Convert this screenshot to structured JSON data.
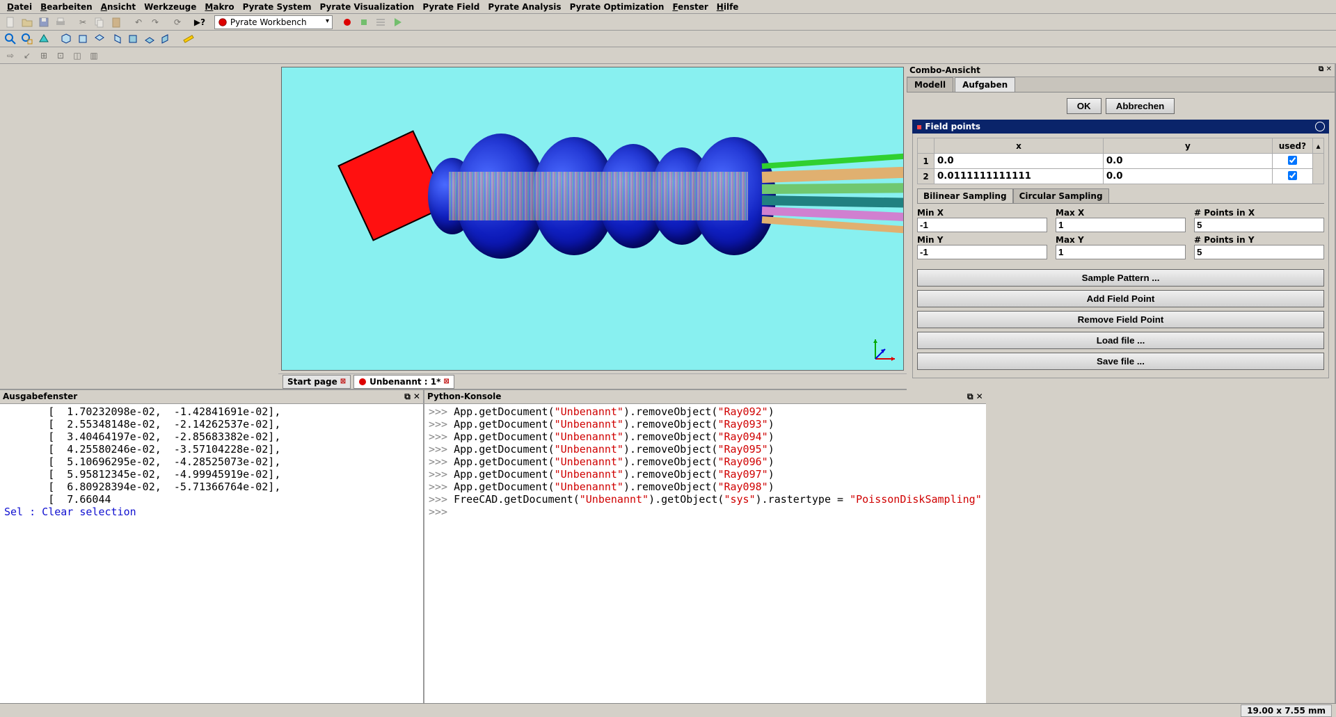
{
  "menu": {
    "datei": "Datei",
    "bearbeiten": "Bearbeiten",
    "ansicht": "Ansicht",
    "werkzeuge": "Werkzeuge",
    "makro": "Makro",
    "psystem": "Pyrate System",
    "pvisual": "Pyrate Visualization",
    "pfield": "Pyrate Field",
    "panalysis": "Pyrate Analysis",
    "poptim": "Pyrate Optimization",
    "fenster": "Fenster",
    "hilfe": "Hilfe"
  },
  "workbench": "Pyrate Workbench",
  "combo": {
    "title": "Combo-Ansicht",
    "tab_model": "Modell",
    "tab_tasks": "Aufgaben",
    "ok": "OK",
    "cancel": "Abbrechen",
    "section": "Field points",
    "col_x": "x",
    "col_y": "y",
    "col_used": "used?",
    "rows": [
      {
        "n": "1",
        "x": "0.0",
        "y": "0.0",
        "used": true
      },
      {
        "n": "2",
        "x": "0.0111111111111",
        "y": "0.0",
        "used": true
      }
    ],
    "sampling_bilinear": "Bilinear Sampling",
    "sampling_circular": "Circular Sampling",
    "minx_label": "Min X",
    "maxx_label": "Max X",
    "pointsx_label": "# Points in X",
    "miny_label": "Min Y",
    "maxy_label": "Max Y",
    "pointsy_label": "# Points in Y",
    "minx": "-1",
    "maxx": "1",
    "pointsx": "5",
    "miny": "-1",
    "maxy": "1",
    "pointsy": "5",
    "btn_sample": "Sample Pattern ...",
    "btn_add": "Add Field Point",
    "btn_remove": "Remove Field Point",
    "btn_load": "Load file ...",
    "btn_save": "Save file ..."
  },
  "doc_tabs": {
    "start": "Start page",
    "unbenannt": "Unbenannt : 1*"
  },
  "output": {
    "title": "Ausgabefenster",
    "lines": [
      "       [  1.70232098e-02,  -1.42841691e-02],",
      "       [  2.55348148e-02,  -2.14262537e-02],",
      "       [  3.40464197e-02,  -2.85683382e-02],",
      "       [  4.25580246e-02,  -3.57104228e-02],",
      "       [  5.10696295e-02,  -4.28525073e-02],",
      "       [  5.95812345e-02,  -4.99945919e-02],",
      "       [  6.80928394e-02,  -5.71366764e-02],",
      "       [  7.66044"
    ],
    "sel": "Sel : Clear selection"
  },
  "pycon": {
    "title": "Python-Konsole",
    "doc": "\"Unbenannt\"",
    "rays": [
      "\"Ray092\"",
      "\"Ray093\"",
      "\"Ray094\"",
      "\"Ray095\"",
      "\"Ray096\"",
      "\"Ray097\"",
      "\"Ray098\""
    ],
    "last_arg": "\"sys\"",
    "last_val": "\"PoissonDiskSampling\"",
    "app": "App",
    "getdoc": ".getDocument(",
    "remobj": ").removeObject(",
    "close": ")",
    "freecad": "FreeCAD",
    "getobj": ").getObject(",
    "raster": ").rastertype = ",
    "prompt": ">>> "
  },
  "status": {
    "coords": "19.00 x 7.55 mm"
  }
}
